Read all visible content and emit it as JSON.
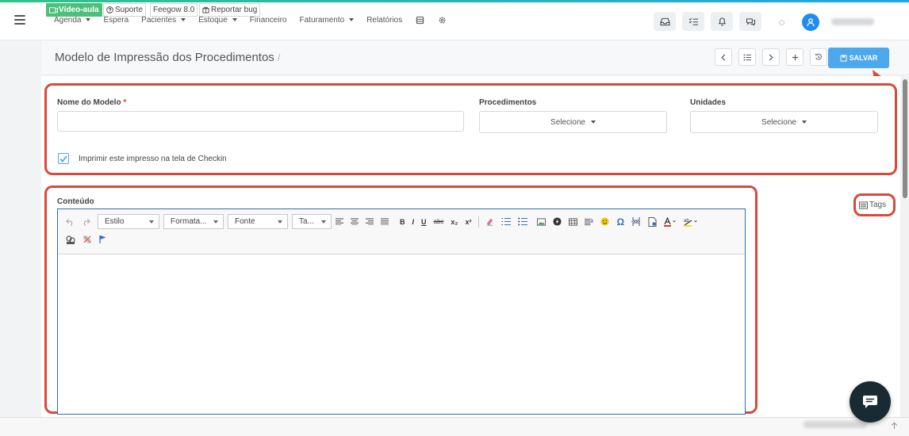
{
  "nav": {
    "items": [
      {
        "label": "Agenda",
        "caret": true
      },
      {
        "label": "Espera",
        "caret": false
      },
      {
        "label": "Pacientes",
        "caret": true
      },
      {
        "label": "Estoque",
        "caret": true
      },
      {
        "label": "Financeiro",
        "caret": false
      },
      {
        "label": "Faturamento",
        "caret": true
      },
      {
        "label": "Relatórios",
        "caret": false
      }
    ],
    "icons": [
      "database-icon",
      "gear-icon"
    ]
  },
  "topbar_icons": [
    "inbox-icon",
    "tasks-icon",
    "bell-icon",
    "chat-bubbles-icon"
  ],
  "page": {
    "title": "Modelo de Impressão dos Procedimentos",
    "breadcrumb_sep": "/",
    "save_label": "SALVAR"
  },
  "form": {
    "nome_label": "Nome do Modelo",
    "required_mark": "*",
    "nome_value": "",
    "procedimentos_label": "Procedimentos",
    "procedimentos_value": "Selecione",
    "unidades_label": "Unidades",
    "unidades_value": "Selecione",
    "checkin_label": "Imprimir este impresso na tela de Checkin",
    "checkin_checked": true
  },
  "editor": {
    "label": "Conteúdo",
    "combos": [
      "Estilo",
      "Formata...",
      "Fonte",
      "Ta..."
    ],
    "format_buttons": [
      "B",
      "I",
      "U",
      "abc",
      "x₂",
      "x²"
    ],
    "omega": "Ω"
  },
  "tags_label": "Tags",
  "footer": {
    "video_label": "Vídeo-aula",
    "suporte_label": "Suporte",
    "version_label": "Feegow 8.0",
    "bug_label": "Reportar bug"
  },
  "colors": {
    "accent": "#4ca9ee",
    "highlight_box": "#d94a3a",
    "green": "#4cc07a",
    "avatar": "#1e8cf0"
  }
}
